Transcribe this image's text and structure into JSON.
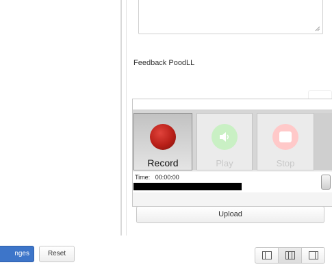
{
  "editor": {
    "feedback_label": "Feedback PoodLL"
  },
  "recorder": {
    "record_label": "Record",
    "play_label": "Play",
    "stop_label": "Stop",
    "time_label": "Time:",
    "time_value": "00:00:00"
  },
  "upload": {
    "label": "Upload"
  },
  "footer": {
    "save_label": "nges",
    "reset_label": "Reset"
  },
  "icons": {
    "record": "record-icon",
    "play": "speaker-icon",
    "stop": "stop-icon",
    "layout_left": "layout-left-panel-icon",
    "layout_center": "layout-center-panel-icon",
    "layout_right": "layout-right-panel-icon"
  },
  "colors": {
    "save_button": "#3d75c9",
    "record": "#c0221b",
    "play_disabled": "#c9f0c4",
    "stop_disabled": "#ffc9c9"
  }
}
